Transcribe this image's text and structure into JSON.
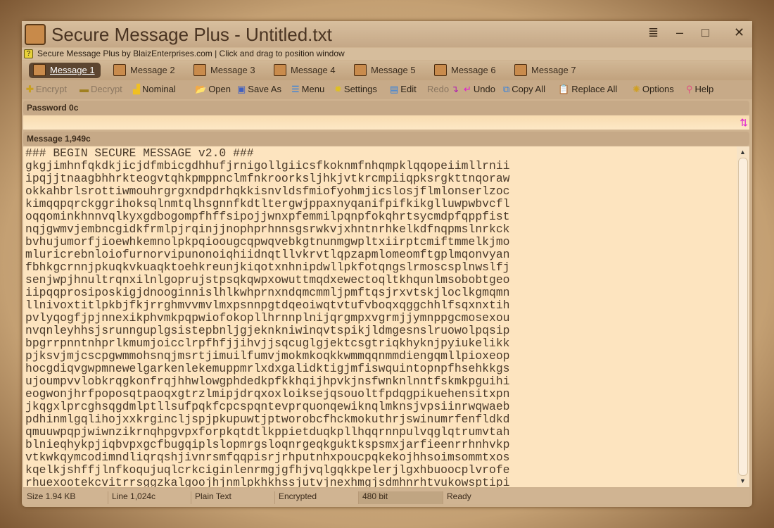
{
  "window": {
    "title": "Secure Message Plus - Untitled.txt",
    "info": "Secure Message Plus by BlaizEnterprises.com | Click and drag to position window",
    "controls": {
      "menu": "≣",
      "minimize": "–",
      "maximize": "□",
      "close": "✕"
    }
  },
  "tabs": [
    "Message 1",
    "Message 2",
    "Message 3",
    "Message 4",
    "Message 5",
    "Message 6",
    "Message 7"
  ],
  "toolbar": {
    "encrypt": "Encrypt",
    "decrypt": "Decrypt",
    "nominal": "Nominal",
    "open": "Open",
    "save_as": "Save As",
    "menu": "Menu",
    "settings": "Settings",
    "edit": "Edit",
    "redo": "Redo",
    "undo": "Undo",
    "copy_all": "Copy All",
    "replace_all": "Replace All",
    "options": "Options",
    "help": "Help"
  },
  "password": {
    "label": "Password 0c",
    "value": ""
  },
  "message": {
    "label": "Message 1,949c",
    "lines": [
      "### BEGIN SECURE MESSAGE v2.0 ###",
      "gkgjimhnfqkdkjicjdfmbicgdhhufjrnigollgiicsfkoknmfnhqmpklqqopeiimllrnii",
      "ipqjjtnaagbhhrkteogvtqhkpmppnclmfnkroorksljhkjvtkrcmpiiqpksrgkttnqoraw",
      "okkahbrlsrottiwmouhrgrgxndpdrhqkkisnvldsfmiofyohmjicslosjflmlonserlzoc",
      "kimqqpqrckggrihoksqlnmtqlhsgnnfkdtltergwjppaxnyqanifpifkikglluwpwbvcfl",
      "oqqominkhnnvqlkyxgdbogompfhffsipojjwnxpfemmilpqnpfokqhrtsycmdpfqppfist",
      "nqjgwmvjembncgidkfrmlpjrqinjjnophprhnnsgsrwkvjxhntnrhkelkdfnqpmslnrkck",
      "bvhujumorfjioewhkemnolpkpqioougcqpwqvebkgtnunmgwpltxiirptcmiftmmelkjmo",
      "mluricrebnloiofurnorvipunonoiqhiidnqtllvkrvtlqpzapmlomeomftgplmqonvyan",
      "fbhkgcrnnjpkuqkvkuaqktoehkreunjkiqotxnhnipdwllpkfotqngslrmoscsplnwslfj",
      "senjwpjhnultrqnxilnlgoprujstpsqkqwpxowuttmqdxewectoqltkhqunlmsobobtgeo",
      "iipqqprosiposkigjdnooginnislhlkwhprnxndqmcmmljpmftqsjrxvtskjloclkgmqmn",
      "llnivoxtitlpkbjfkjrrghmvvmvlmxpsnnpgtdqeoiwqtvtufvboqxqggchhlfsqxnxtih",
      "pvlyqogfjpjnnexikphvmkpqpwiofokopllhrnnplnijqrgmpxvgrmjjymnppgcmosexou",
      "nvqnleyhhsjsrunnguplgsistepbnljgjeknkniwinqvtspikjldmgesnslruowolpqsip",
      "bpgrrpnntnhprlkmumjoicclrpfhfjjihvjjsqcuglgjektcsgtriqkhyknjpyiukelikk",
      "pjksvjmjcscpgwmmohsnqjmsrtjimuilfumvjmokmkoqkkwmmqqnmmdiengqmllpioxeop",
      "hocgdiqvgwpmnewelgarkenlekemuppmrlxdxgalidktigjmfiswquintopnpfhsehkkgs",
      "ujoumpvvlobkrqgkonfrqjhhwlowgphdedkpfkkhqijhpvkjnsfwnknlnntfskmkpguihi",
      "eogwonjhrfpoposqtpaoqxgtrzlmipjdrqxoxloiksejqsouoltfpdqgpikuehensitxpn",
      "jkqgxlprcghsqgdmlptllsufpqkfcpcspqntevprquonqewiknqlmknsjvpsiinrwqwaeb",
      "pdhinmlgqlihojxxkrgincljspjpkupuwtjptworobcfhckmokuthrjswinumrfenfldkd",
      "qmuuwpqpjwiwnzikrnqhpgvpxforpkqtdtlkppietduqkpllhqqrnnpulvqglqtrumvtah",
      "blnieqhykpjiqbvpxgcfbugqiplslopmrgsloqnrgeqkguktkspsmxjarfieenrrhnhvkp",
      "vtkwkqymcodimndliqrqshjivnrsmfqqpisrjrhputnhxpoucpqkekojhhsoimsommtxos",
      "kqelkjshffjlnfkoqujuqlcrkciginlenrmgjgfhjvqlgqkkpelerjlgxhbuoocplvrofe",
      "rhuexootekcvitrrsggzkalgoojhjnmlpkhkhssjutvjnexhmgjsdmhnrhtvukowsptipi"
    ]
  },
  "status": {
    "size": "Size 1.94 KB",
    "line": "Line 1,024c",
    "format": "Plain Text",
    "state": "Encrypted",
    "bits": "480 bit",
    "ready": "Ready"
  }
}
